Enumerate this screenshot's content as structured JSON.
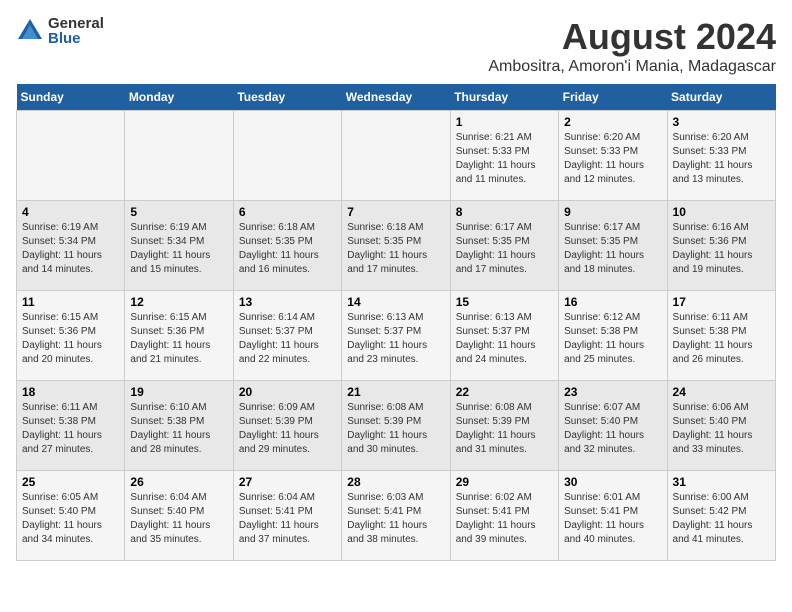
{
  "logo": {
    "general": "General",
    "blue": "Blue"
  },
  "title": "August 2024",
  "subtitle": "Ambositra, Amoron'i Mania, Madagascar",
  "weekdays": [
    "Sunday",
    "Monday",
    "Tuesday",
    "Wednesday",
    "Thursday",
    "Friday",
    "Saturday"
  ],
  "weeks": [
    [
      {
        "day": "",
        "info": ""
      },
      {
        "day": "",
        "info": ""
      },
      {
        "day": "",
        "info": ""
      },
      {
        "day": "",
        "info": ""
      },
      {
        "day": "1",
        "info": "Sunrise: 6:21 AM\nSunset: 5:33 PM\nDaylight: 11 hours\nand 11 minutes."
      },
      {
        "day": "2",
        "info": "Sunrise: 6:20 AM\nSunset: 5:33 PM\nDaylight: 11 hours\nand 12 minutes."
      },
      {
        "day": "3",
        "info": "Sunrise: 6:20 AM\nSunset: 5:33 PM\nDaylight: 11 hours\nand 13 minutes."
      }
    ],
    [
      {
        "day": "4",
        "info": "Sunrise: 6:19 AM\nSunset: 5:34 PM\nDaylight: 11 hours\nand 14 minutes."
      },
      {
        "day": "5",
        "info": "Sunrise: 6:19 AM\nSunset: 5:34 PM\nDaylight: 11 hours\nand 15 minutes."
      },
      {
        "day": "6",
        "info": "Sunrise: 6:18 AM\nSunset: 5:35 PM\nDaylight: 11 hours\nand 16 minutes."
      },
      {
        "day": "7",
        "info": "Sunrise: 6:18 AM\nSunset: 5:35 PM\nDaylight: 11 hours\nand 17 minutes."
      },
      {
        "day": "8",
        "info": "Sunrise: 6:17 AM\nSunset: 5:35 PM\nDaylight: 11 hours\nand 17 minutes."
      },
      {
        "day": "9",
        "info": "Sunrise: 6:17 AM\nSunset: 5:35 PM\nDaylight: 11 hours\nand 18 minutes."
      },
      {
        "day": "10",
        "info": "Sunrise: 6:16 AM\nSunset: 5:36 PM\nDaylight: 11 hours\nand 19 minutes."
      }
    ],
    [
      {
        "day": "11",
        "info": "Sunrise: 6:15 AM\nSunset: 5:36 PM\nDaylight: 11 hours\nand 20 minutes."
      },
      {
        "day": "12",
        "info": "Sunrise: 6:15 AM\nSunset: 5:36 PM\nDaylight: 11 hours\nand 21 minutes."
      },
      {
        "day": "13",
        "info": "Sunrise: 6:14 AM\nSunset: 5:37 PM\nDaylight: 11 hours\nand 22 minutes."
      },
      {
        "day": "14",
        "info": "Sunrise: 6:13 AM\nSunset: 5:37 PM\nDaylight: 11 hours\nand 23 minutes."
      },
      {
        "day": "15",
        "info": "Sunrise: 6:13 AM\nSunset: 5:37 PM\nDaylight: 11 hours\nand 24 minutes."
      },
      {
        "day": "16",
        "info": "Sunrise: 6:12 AM\nSunset: 5:38 PM\nDaylight: 11 hours\nand 25 minutes."
      },
      {
        "day": "17",
        "info": "Sunrise: 6:11 AM\nSunset: 5:38 PM\nDaylight: 11 hours\nand 26 minutes."
      }
    ],
    [
      {
        "day": "18",
        "info": "Sunrise: 6:11 AM\nSunset: 5:38 PM\nDaylight: 11 hours\nand 27 minutes."
      },
      {
        "day": "19",
        "info": "Sunrise: 6:10 AM\nSunset: 5:38 PM\nDaylight: 11 hours\nand 28 minutes."
      },
      {
        "day": "20",
        "info": "Sunrise: 6:09 AM\nSunset: 5:39 PM\nDaylight: 11 hours\nand 29 minutes."
      },
      {
        "day": "21",
        "info": "Sunrise: 6:08 AM\nSunset: 5:39 PM\nDaylight: 11 hours\nand 30 minutes."
      },
      {
        "day": "22",
        "info": "Sunrise: 6:08 AM\nSunset: 5:39 PM\nDaylight: 11 hours\nand 31 minutes."
      },
      {
        "day": "23",
        "info": "Sunrise: 6:07 AM\nSunset: 5:40 PM\nDaylight: 11 hours\nand 32 minutes."
      },
      {
        "day": "24",
        "info": "Sunrise: 6:06 AM\nSunset: 5:40 PM\nDaylight: 11 hours\nand 33 minutes."
      }
    ],
    [
      {
        "day": "25",
        "info": "Sunrise: 6:05 AM\nSunset: 5:40 PM\nDaylight: 11 hours\nand 34 minutes."
      },
      {
        "day": "26",
        "info": "Sunrise: 6:04 AM\nSunset: 5:40 PM\nDaylight: 11 hours\nand 35 minutes."
      },
      {
        "day": "27",
        "info": "Sunrise: 6:04 AM\nSunset: 5:41 PM\nDaylight: 11 hours\nand 37 minutes."
      },
      {
        "day": "28",
        "info": "Sunrise: 6:03 AM\nSunset: 5:41 PM\nDaylight: 11 hours\nand 38 minutes."
      },
      {
        "day": "29",
        "info": "Sunrise: 6:02 AM\nSunset: 5:41 PM\nDaylight: 11 hours\nand 39 minutes."
      },
      {
        "day": "30",
        "info": "Sunrise: 6:01 AM\nSunset: 5:41 PM\nDaylight: 11 hours\nand 40 minutes."
      },
      {
        "day": "31",
        "info": "Sunrise: 6:00 AM\nSunset: 5:42 PM\nDaylight: 11 hours\nand 41 minutes."
      }
    ]
  ]
}
